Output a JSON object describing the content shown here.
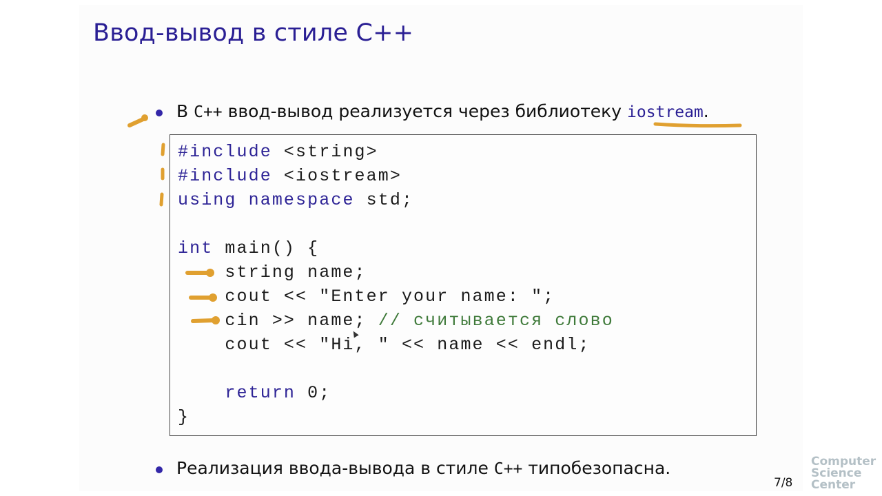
{
  "slide": {
    "title": "Ввод-вывод в стиле C++",
    "bullets": [
      {
        "prefix": "В ",
        "mono": "C++",
        "middle": " ввод-вывод реализуется через библиотеку ",
        "code": "iostream",
        "suffix": "."
      },
      {
        "prefix": "Реализация ввода-вывода в стиле ",
        "mono": "C++",
        "suffix": " типобезопасна."
      }
    ],
    "code": {
      "lines": [
        [
          {
            "t": "#include",
            "c": "kw"
          },
          {
            "t": " <string>",
            "c": ""
          }
        ],
        [
          {
            "t": "#include",
            "c": "kw"
          },
          {
            "t": " <iostream>",
            "c": ""
          }
        ],
        [
          {
            "t": "using",
            "c": "kw"
          },
          {
            "t": " ",
            "c": ""
          },
          {
            "t": "namespace",
            "c": "kw"
          },
          {
            "t": " std;",
            "c": ""
          }
        ],
        [
          {
            "t": "",
            "c": ""
          }
        ],
        [
          {
            "t": "int",
            "c": "kw"
          },
          {
            "t": " main() {",
            "c": ""
          }
        ],
        [
          {
            "t": "    string name;",
            "c": ""
          }
        ],
        [
          {
            "t": "    cout << \"Enter your name: \";",
            "c": ""
          }
        ],
        [
          {
            "t": "    cin >> name; ",
            "c": ""
          },
          {
            "t": "// считывается слово",
            "c": "cm"
          }
        ],
        [
          {
            "t": "    cout << \"Hi, \" << name << endl;",
            "c": ""
          }
        ],
        [
          {
            "t": "",
            "c": ""
          }
        ],
        [
          {
            "t": "    ",
            "c": ""
          },
          {
            "t": "return",
            "c": "kw"
          },
          {
            "t": " 0;",
            "c": ""
          }
        ],
        [
          {
            "t": "}",
            "c": ""
          }
        ]
      ]
    },
    "page_number": "7/8",
    "logo": [
      "Computer",
      "Science",
      "Center"
    ]
  },
  "colors": {
    "title": "#2a1f94",
    "keyword": "#2e2496",
    "comment": "#3f7a3a",
    "annotation": "#e0a030",
    "logo": "#b4c0c6"
  }
}
